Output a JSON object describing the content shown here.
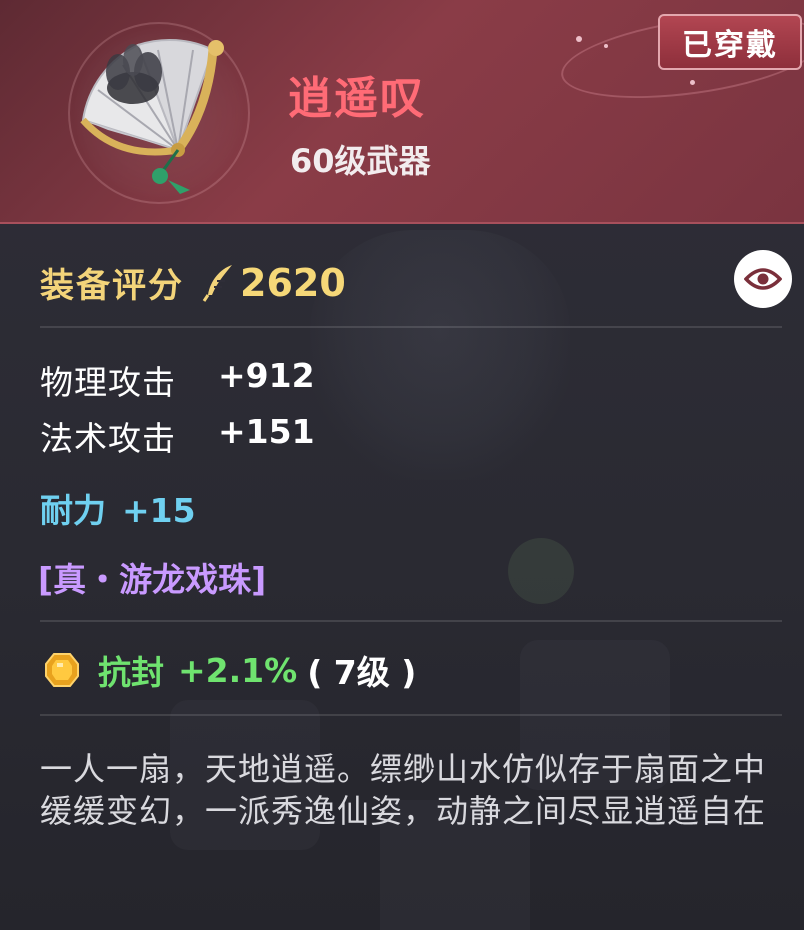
{
  "item": {
    "name": "逍遥叹",
    "level_type": "60级武器",
    "worn_badge": "已穿戴"
  },
  "score": {
    "label": "装备评分",
    "value": "2620"
  },
  "base_stats": [
    {
      "name": "物理攻击",
      "value": "+912"
    },
    {
      "name": "法术攻击",
      "value": "+151"
    }
  ],
  "bonus_stat": {
    "name": "耐力",
    "value": "+15"
  },
  "special_effect": "[真・游龙戏珠]",
  "gem": {
    "name": "抗封",
    "value": "+2.1%",
    "level": "( 7级 )"
  },
  "description": "一人一扇，天地逍遥。缥缈山水仿似存于扇面之中缓缓变幻，一派秀逸仙姿，动静之间尽显逍遥自在",
  "colors": {
    "header_bg": "#8a3c47",
    "item_name": "#ff6b76",
    "score": "#f6d878",
    "endurance": "#6fd0f0",
    "special": "#c99aff",
    "gem_stat": "#6fe36f"
  },
  "icons": [
    "fan-weapon-icon",
    "quill-icon",
    "eye-icon",
    "gem-icon"
  ]
}
